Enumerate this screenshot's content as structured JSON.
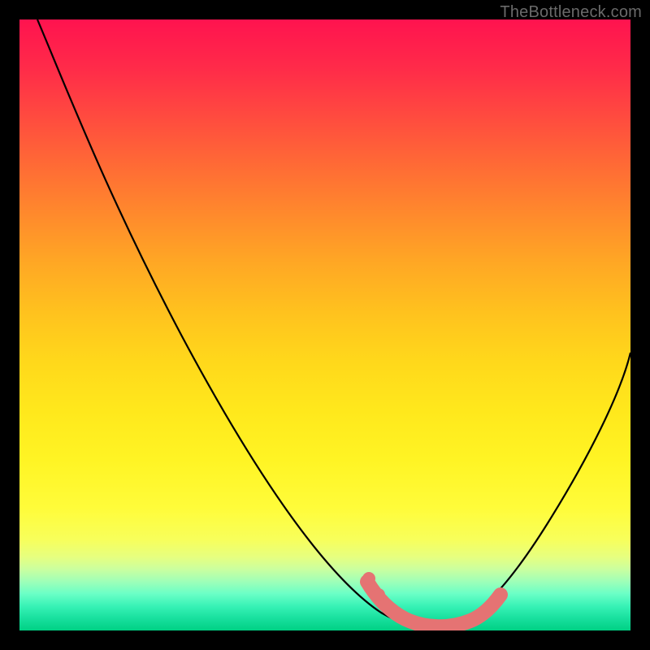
{
  "watermark": "TheBottleneck.com",
  "chart_data": {
    "type": "line",
    "title": "",
    "xlabel": "",
    "ylabel": "",
    "xlim": [
      0,
      100
    ],
    "ylim": [
      0,
      100
    ],
    "series": [
      {
        "name": "bottleneck-curve",
        "x": [
          3,
          10,
          20,
          30,
          40,
          50,
          57,
          60,
          63,
          66,
          70,
          74,
          80,
          86,
          92,
          100
        ],
        "y": [
          100,
          86,
          69,
          52,
          36,
          20,
          8,
          4,
          1,
          0,
          0,
          1,
          8,
          18,
          30,
          46
        ]
      },
      {
        "name": "highlight-band",
        "x": [
          57,
          59,
          61,
          63,
          65,
          67,
          69,
          71,
          73,
          75,
          77
        ],
        "y": [
          8,
          5,
          3,
          1.5,
          0.6,
          0.2,
          0.4,
          1,
          2.2,
          4,
          6.5
        ]
      }
    ],
    "colors": {
      "curve": "#000000",
      "highlight": "#e57373",
      "bg_top": "#ff134f",
      "bg_bottom": "#00d184"
    }
  }
}
